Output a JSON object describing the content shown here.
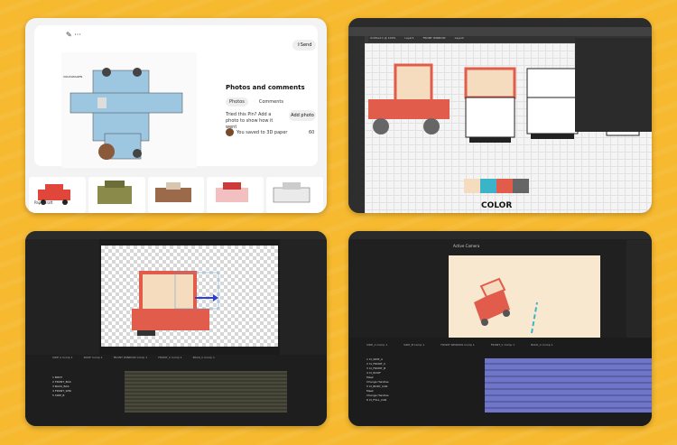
{
  "panels": {
    "pinterest": {
      "send_label": "Send",
      "menu_label": "···",
      "title": "Photos and comments",
      "tab_photos": "Photos",
      "tab_comments": "Comments",
      "tried_text": "Tried this Pin? Add a photo to show how it went",
      "add_photo_label": "Add photo",
      "saved_text": "You saved to 3D paper",
      "count": "60",
      "strip_label": "Papercraft"
    },
    "illustrator": {
      "color_label": "COLOR",
      "tabs": [
        "Untitled-1 @ 100%",
        "Layer1",
        "FRONT WINDOW",
        "Layer2"
      ]
    },
    "aftereffects": {
      "tl_tabs": [
        "SIDE A Comp 1",
        "ROOF Comp 1",
        "FRONT WINDOW Comp 1",
        "FRONT_C Comp 1",
        "BACK_C Comp 1"
      ],
      "rows": [
        "1 BODY",
        "2 FRONT_BAS",
        "3 BACK_BAS",
        "4 FRONT_WIN",
        "5 SIDE_B"
      ]
    },
    "aftereffects2": {
      "header": "Active Camera",
      "tabs": [
        "SIDE_A Comp 1",
        "SIDE_B Comp 1",
        "FRONT WINDOW Comp 1",
        "FRONT_C Comp 1",
        "BACK_C Comp 1"
      ],
      "rows": [
        "1  CI_SIDE_A",
        "2  CI_FRONT_C",
        "3  CI_FRONT_B",
        "4  CI_ROOF",
        "Mask",
        "Change Handles",
        "5  CI_BODY_CAR",
        "Mask",
        "Change Handles",
        "6  CI_FULL_CAR"
      ]
    }
  },
  "colors": {
    "bg": "#f6b92f",
    "red": "#e15c4b",
    "peach": "#f5dcbf",
    "teal": "#3bb3c8",
    "gray": "#666666"
  }
}
